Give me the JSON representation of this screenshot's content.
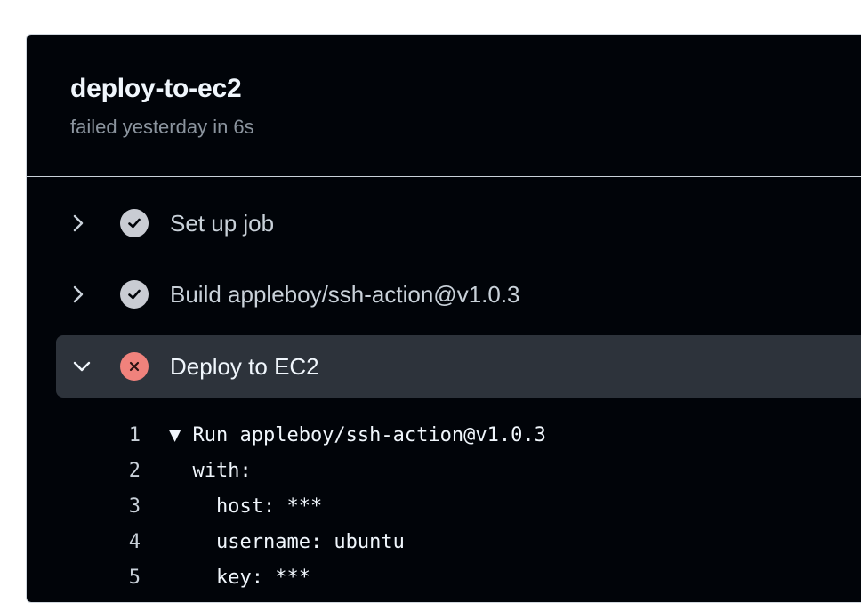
{
  "job": {
    "title": "deploy-to-ec2",
    "status_text": "failed yesterday in 6s"
  },
  "steps": [
    {
      "label": "Set up job",
      "status": "success",
      "expanded": false
    },
    {
      "label": "Build appleboy/ssh-action@v1.0.3",
      "status": "success",
      "expanded": false
    },
    {
      "label": "Deploy to EC2",
      "status": "failure",
      "expanded": true
    }
  ],
  "log": {
    "lines": [
      {
        "n": "1",
        "text": "▼ Run appleboy/ssh-action@v1.0.3"
      },
      {
        "n": "2",
        "text": "  with:"
      },
      {
        "n": "3",
        "text": "    host: ***"
      },
      {
        "n": "4",
        "text": "    username: ubuntu"
      },
      {
        "n": "5",
        "text": "    key: ***"
      }
    ]
  },
  "colors": {
    "panel_bg": "#010409",
    "expanded_row_bg": "#2d333b",
    "success_icon": "#c9ccd3",
    "failure_icon": "#f0827c"
  }
}
